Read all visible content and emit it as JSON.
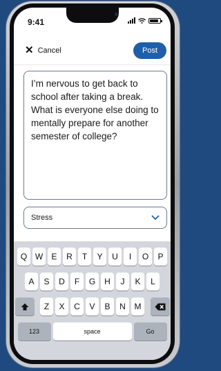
{
  "status_bar": {
    "time": "9:41"
  },
  "header": {
    "cancel_label": "Cancel",
    "post_label": "Post"
  },
  "post_text": "I’m nervous to get back to school after taking a break. What is everyone else doing to mentally prepare for another semester of college?",
  "category": {
    "selected": "Stress"
  },
  "keyboard": {
    "row1": [
      "Q",
      "W",
      "E",
      "R",
      "T",
      "Y",
      "U",
      "I",
      "O",
      "P"
    ],
    "row2": [
      "A",
      "S",
      "D",
      "F",
      "G",
      "H",
      "J",
      "K",
      "L"
    ],
    "row3": [
      "Z",
      "X",
      "C",
      "V",
      "B",
      "N",
      "M"
    ],
    "numbers_label": "123",
    "space_label": "space",
    "go_label": "Go"
  },
  "colors": {
    "accent": "#1f5faa",
    "background": "#1f4a80",
    "keyboard_bg": "#d3d6dc"
  }
}
